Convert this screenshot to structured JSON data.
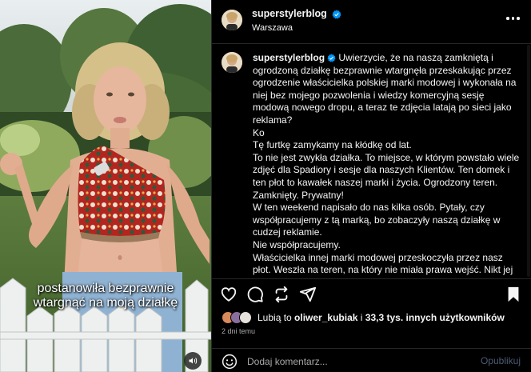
{
  "post": {
    "username": "superstylerblog",
    "location": "Warszawa",
    "caption_lines": [
      "Uwierzycie, że na naszą zamkniętą i ogrodzoną działkę bezprawnie wtargnęła przeskakując przez ogrodzenie właścicielka polskiej marki modowej i wykonała na niej bez mojego pozwolenia i wiedzy komercyjną sesję modową nowego dropu, a teraz te zdjęcia latają po sieci jako reklama?",
      "Ko",
      "Tę furtkę zamykamy na kłódkę od lat.",
      "To nie jest zwykła działka. To miejsce, w którym powstało wiele zdjęć dla Spadiory i sesje dla naszych Klientów. Ten domek i ten płot to kawałek naszej marki i życia. Ogrodzony teren. Zamknięty. Prywatny!",
      "W ten weekend napisało do nas kilka osób. Pytały, czy współpracujemy z tą marką, bo zobaczyły naszą działkę w cudzej reklamie.",
      "Nie współpracujemy.",
      "Właścicielka innej marki modowej przeskoczyła przez nasz płot. Weszła na teren, na który nie miała prawa wejść. Nikt jej nie wpuścił, nikt jej nie zaprosił, nikt o niczym nie wiedział, nie pytała o zgodę. Nie tylko weszła na nasz teren, ale również położyła się"
    ],
    "likes": {
      "prefix": "Lubią to",
      "user": "oliwer_kubiak",
      "middle": "i",
      "others": "33,3 tys. innych użytkowników"
    },
    "time_ago": "2 dni temu"
  },
  "video": {
    "subtitle_line1": "postanowiła bezprawnie",
    "subtitle_line2": "wtargnąć na moją działkę"
  },
  "comment": {
    "placeholder": "Dodaj komentarz...",
    "publish_label": "Opublikuj"
  },
  "icons": {
    "verified": "verified-badge-icon",
    "more": "more-options-icon",
    "like": "heart-icon",
    "comment": "comment-bubble-icon",
    "share": "paper-plane-icon",
    "save": "bookmark-icon",
    "emoji": "emoji-icon",
    "mute": "speaker-icon"
  },
  "colors": {
    "background": "#000000",
    "text": "#f5f5f5",
    "secondary_text": "#a8a8a8",
    "verified": "#0095f6",
    "publish_disabled": "#4d5a73",
    "divider": "#262626"
  }
}
